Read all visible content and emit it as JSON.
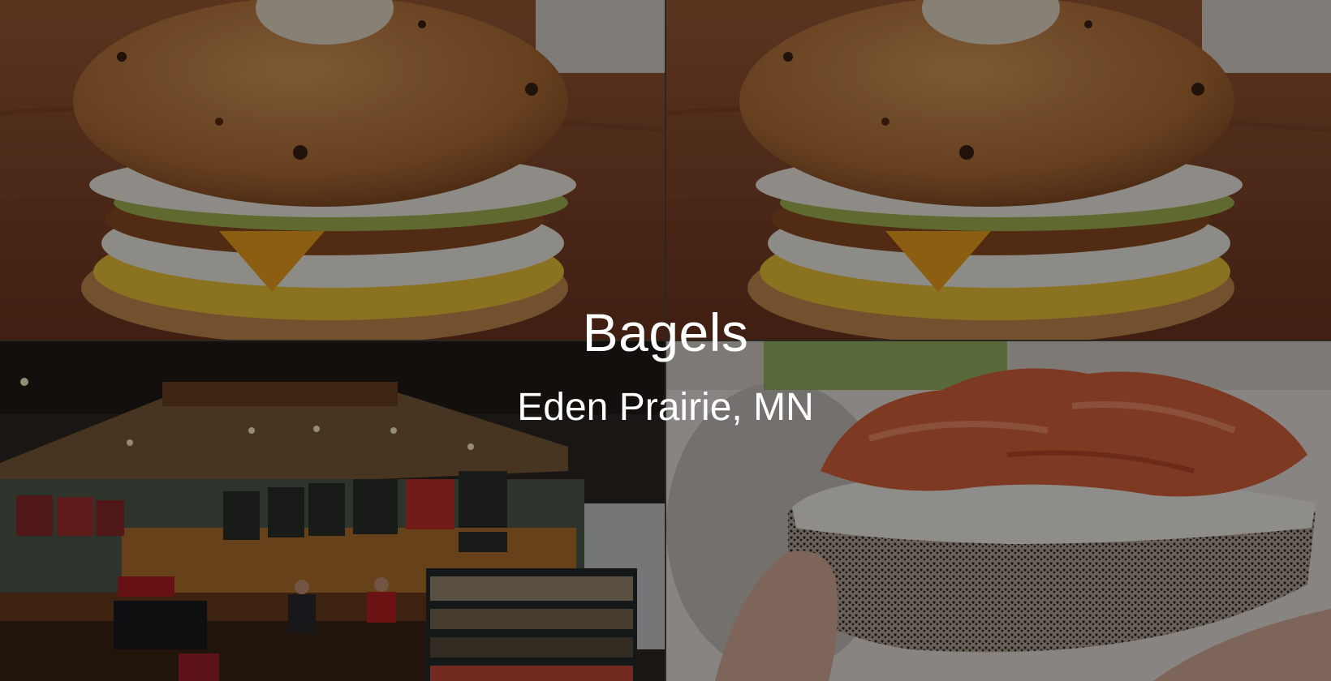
{
  "hero": {
    "title": "Bagels",
    "subtitle": "Eden Prairie, MN"
  },
  "photos": [
    {
      "name": "breakfast-bagel-sandwich-photo"
    },
    {
      "name": "breakfast-bagel-sandwich-photo"
    },
    {
      "name": "bagel-shop-interior-photo"
    },
    {
      "name": "lox-poppy-seed-bagel-photo"
    }
  ],
  "colors": {
    "overlay": "#000000",
    "text": "#ffffff",
    "wood": "#8a4a2c",
    "bagel": "#b8783f",
    "egg": "#e6b52a",
    "salmon": "#d8623a"
  }
}
